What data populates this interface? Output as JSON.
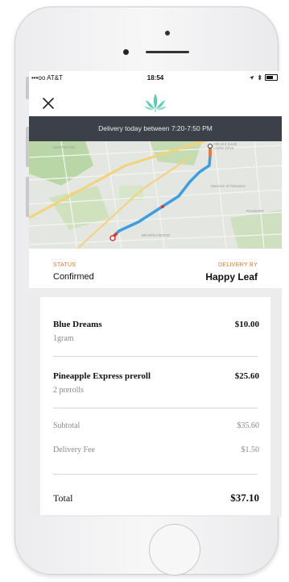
{
  "status_bar": {
    "carrier": "•••oo AT&T",
    "time": "18:54"
  },
  "banner": {
    "text": "Delivery today between 7:20-7:50 PM"
  },
  "map": {
    "destination_label_line1": "299 513 South",
    "destination_label_line2": "Linden Drive",
    "poi_label": "Museum of Tolerance",
    "area_label_1": "WESTWOOD",
    "area_label_2": "BEVERLYWOOD",
    "area_label_3": "ROXBURY",
    "route_color": "#3d9ee0"
  },
  "order": {
    "status_label": "STATUS",
    "status_value": "Confirmed",
    "delivery_label": "DELIVERY BY",
    "delivery_value": "Happy Leaf"
  },
  "items": [
    {
      "name": "Blue Dreams",
      "quantity": "1gram",
      "price": "$10.00"
    },
    {
      "name": "Pineapple Express preroll",
      "quantity": "2 prerolls",
      "price": "$25.60"
    }
  ],
  "summary": {
    "subtotal_label": "Subtotal",
    "subtotal_value": "$35.60",
    "fee_label": "Delivery Fee",
    "fee_value": "$1.50",
    "total_label": "Total",
    "total_value": "$37.10"
  },
  "colors": {
    "accent": "#f0722a",
    "banner_bg": "#3b4049",
    "logo_green": "#5ccdb3"
  }
}
